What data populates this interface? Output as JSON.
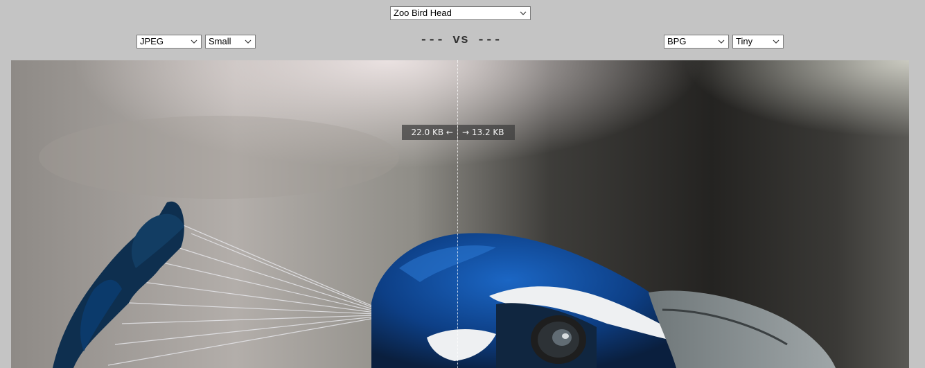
{
  "image_selector": {
    "value": "Zoo Bird Head"
  },
  "left": {
    "codec": "JPEG",
    "size": "Small",
    "file_size_text": "22.0 KB ←"
  },
  "right": {
    "codec": "BPG",
    "size": "Tiny",
    "file_size_text": "→ 13.2 KB"
  },
  "vs_label": "--- vs ---",
  "colors": {
    "page_background": "#c4c4c4",
    "feather_blue": "#0f4f9e",
    "label_background": "#3c3c3c"
  },
  "icons": {
    "dropdown": "chevron-down-icon"
  }
}
